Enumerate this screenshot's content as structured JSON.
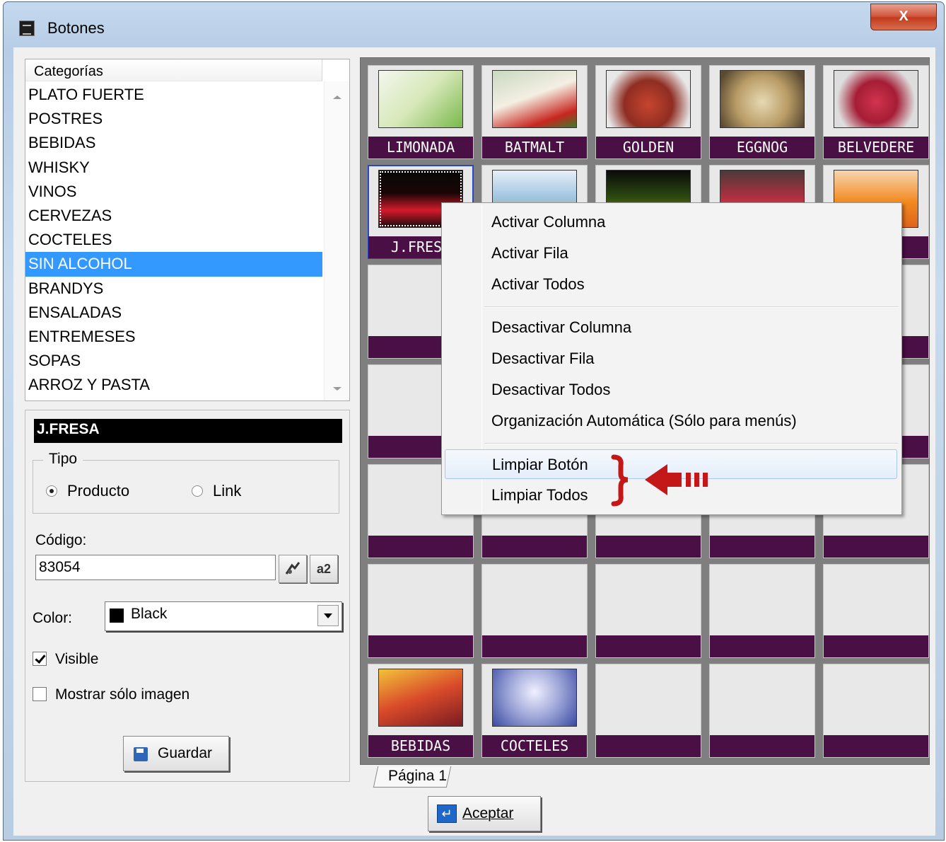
{
  "window": {
    "title": "Botones",
    "close_glyph": "X"
  },
  "categories": {
    "header": "Categorías",
    "items": [
      "PLATO FUERTE",
      "POSTRES",
      "BEBIDAS",
      "WHISKY",
      "VINOS",
      "CERVEZAS",
      "COCTELES",
      "SIN ALCOHOL",
      "BRANDYS",
      "ENSALADAS",
      "ENTREMESES",
      "SOPAS",
      "ARROZ Y PASTA"
    ],
    "selected": "SIN ALCOHOL"
  },
  "details": {
    "name": "J.FRESA",
    "tipo_label": "Tipo",
    "tipo_options": [
      "Producto",
      "Link"
    ],
    "tipo_selected": "Producto",
    "codigo_label": "Código:",
    "codigo_value": "83054",
    "tool_buttons": [
      "search-products-icon",
      "a2"
    ],
    "color_label": "Color:",
    "color_value": "Black",
    "color_swatch": "#000000",
    "visible_label": "Visible",
    "visible_checked": true,
    "solo_imagen_label": "Mostrar sólo imagen",
    "solo_imagen_checked": false,
    "save_label": "Guardar"
  },
  "grid": {
    "band_color": "#4a0f45",
    "rows": [
      [
        "LIMONADA",
        "BATMALT",
        "GOLDEN",
        "EGGNOG",
        "BELVEDERE"
      ],
      [
        "J.FRESA",
        "",
        "",
        "",
        ""
      ],
      [
        "",
        "",
        "",
        "",
        ""
      ],
      [
        "",
        "",
        "",
        "",
        ""
      ],
      [
        "",
        "",
        "",
        "",
        ""
      ],
      [
        "",
        "",
        "",
        "",
        ""
      ],
      [
        "BEBIDAS",
        "COCTELES",
        "",
        "",
        ""
      ]
    ],
    "images": [
      [
        "lime-drink",
        "strawberry-shake",
        "red-drink",
        "eggnog",
        "cocktail-glass"
      ],
      [
        "strawberry-slush",
        "orange-juice",
        "fruit-cocktail",
        "red-smoothie",
        "orange-juice-2"
      ],
      [
        "",
        "",
        "",
        "",
        ""
      ],
      [
        "",
        "",
        "",
        "",
        ""
      ],
      [
        "",
        "",
        "",
        "",
        ""
      ],
      [
        "",
        "",
        "",
        "",
        ""
      ],
      [
        "fruit-drinks",
        "martini",
        "",
        "",
        ""
      ]
    ],
    "selected": "J.FRESA",
    "page_tab": "Página 1"
  },
  "context_menu": {
    "items": [
      "Activar Columna",
      "Activar Fila",
      "Activar Todos",
      "Desactivar Columna",
      "Desactivar Fila",
      "Desactivar Todos",
      "Organización Automática (Sólo para menús)",
      "Limpiar Botón",
      "Limpiar Todos"
    ],
    "highlighted": "Limpiar Botón"
  },
  "accept_label": "Aceptar"
}
